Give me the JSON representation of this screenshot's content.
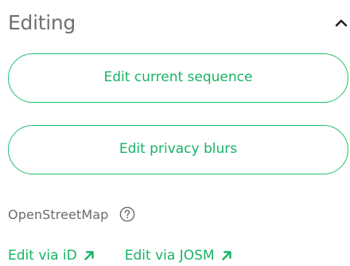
{
  "section": {
    "title": "Editing",
    "collapse_icon": "chevron-up-icon"
  },
  "buttons": {
    "edit_sequence": "Edit current sequence",
    "edit_blurs": "Edit privacy blurs"
  },
  "osm": {
    "label": "OpenStreetMap",
    "help_icon": "question-circle-icon"
  },
  "links": [
    {
      "label": "Edit via iD",
      "icon": "arrow-up-right-icon"
    },
    {
      "label": "Edit via JOSM",
      "icon": "arrow-up-right-icon"
    }
  ],
  "colors": {
    "accent": "#17b364",
    "title": "#707070",
    "muted": "#6b6b6b"
  }
}
